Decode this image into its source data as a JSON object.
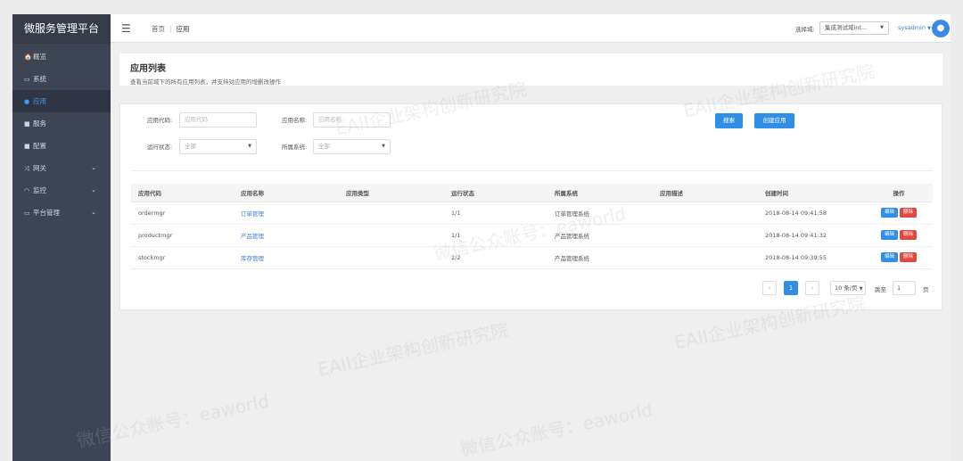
{
  "sidebar": {
    "brand": "微服务管理平台",
    "items": [
      {
        "icon": "🏠",
        "label": "概览"
      },
      {
        "icon": "▭",
        "label": "系统"
      },
      {
        "icon": "●",
        "label": "应用"
      },
      {
        "icon": "■",
        "label": "服务"
      },
      {
        "icon": "■",
        "label": "配置"
      },
      {
        "icon": "⤨",
        "label": "网关",
        "chevron": "⌄"
      },
      {
        "icon": "◠",
        "label": "监控",
        "chevron": "⌄"
      },
      {
        "icon": "▭",
        "label": "平台管理",
        "chevron": "⌄"
      }
    ]
  },
  "topbar": {
    "breadcrumb_home": "首页",
    "breadcrumb_current": "应用",
    "domain_label": "选择域:",
    "domain_value": "集成测试域int...",
    "user": "sysadmin"
  },
  "page": {
    "title": "应用列表",
    "subtitle": "查看当前域下的所有应用列表，并支持对应用的增删改操作"
  },
  "filters": {
    "app_code_label": "应用代码:",
    "app_code_placeholder": "应用代码",
    "app_name_label": "应用名称:",
    "app_name_placeholder": "应用名称",
    "status_label": "运行状态:",
    "status_value": "全部",
    "system_label": "所属系统:",
    "system_value": "全部",
    "search_button": "搜索",
    "create_button": "创建应用"
  },
  "table": {
    "headers": [
      "应用代码",
      "应用名称",
      "应用类型",
      "运行状态",
      "所属系统",
      "应用描述",
      "创建时间",
      "操作"
    ],
    "rows": [
      {
        "code": "ordermgr",
        "name": "订单管理",
        "type": "",
        "status": "1/1",
        "system": "订单管理系统",
        "desc": "",
        "created": "2018-08-14 09:41:58"
      },
      {
        "code": "productmgr",
        "name": "产品管理",
        "type": "",
        "status": "1/1",
        "system": "产品管理系统",
        "desc": "",
        "created": "2018-08-14 09:41:32"
      },
      {
        "code": "stockmgr",
        "name": "库存管理",
        "type": "",
        "status": "2/2",
        "system": "产品管理系统",
        "desc": "",
        "created": "2018-08-14 09:39:55"
      }
    ],
    "edit_label": "编辑",
    "delete_label": "删除"
  },
  "pagination": {
    "prev": "‹",
    "current": "1",
    "next": "›",
    "page_size": "10 条/页",
    "goto_label": "跳至",
    "goto_value": "1",
    "page_unit": "页"
  },
  "watermark": {
    "line1": "EAII企业架构创新研究院",
    "line2": "微信公众账号：eaworld"
  },
  "colors": {
    "sidebar_bg": "#3d4453",
    "primary": "#2f8ee6",
    "danger": "#e2483d",
    "link": "#3d7de0"
  }
}
